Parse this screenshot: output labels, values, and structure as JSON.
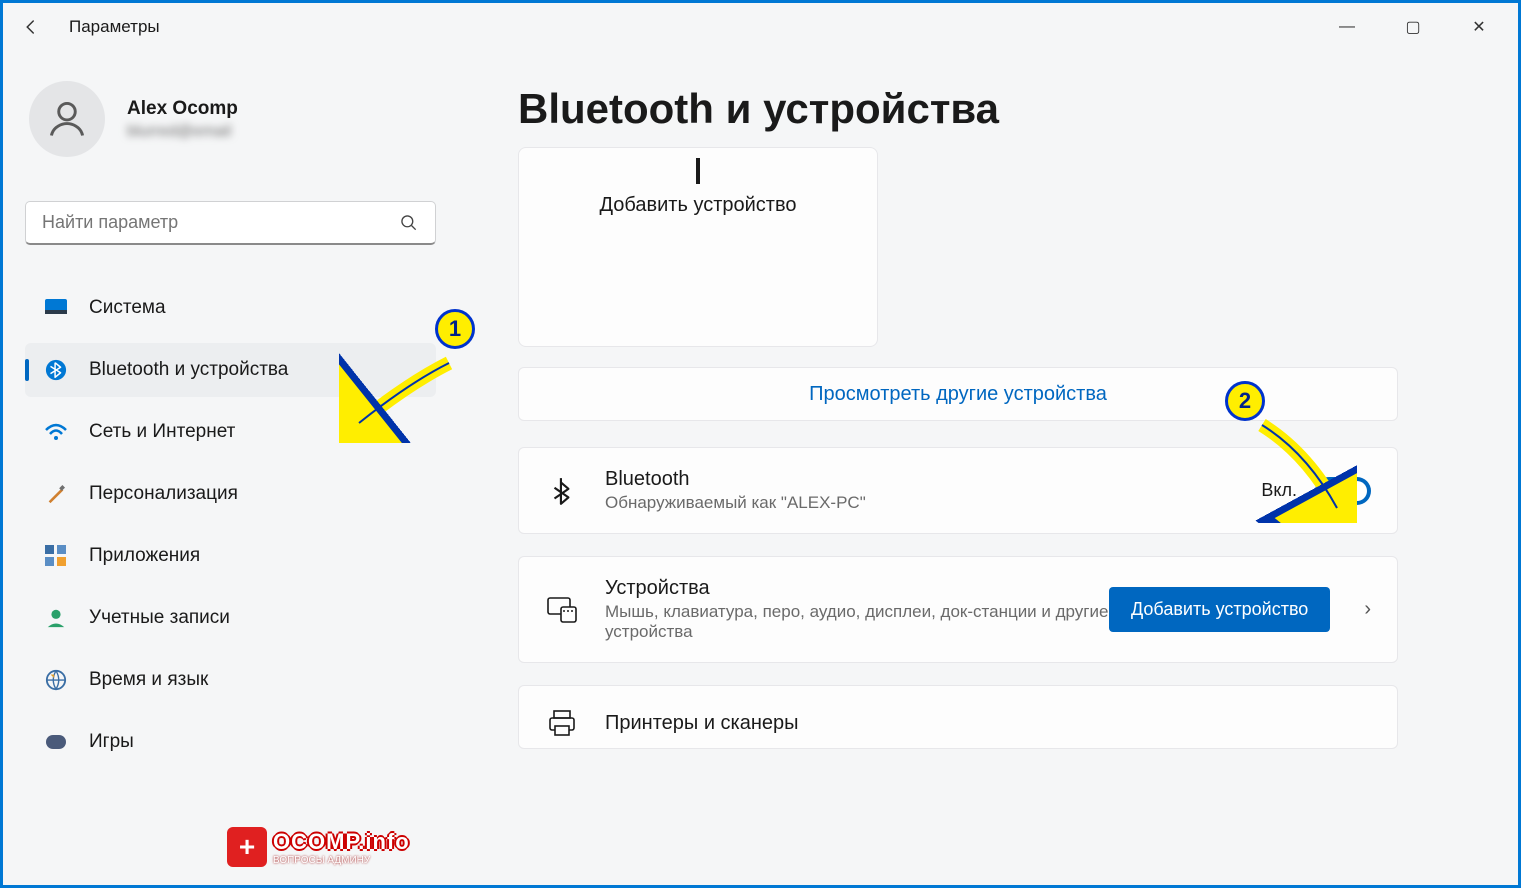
{
  "window": {
    "app_title": "Параметры"
  },
  "profile": {
    "name": "Alex Ocomp",
    "email": "blurred@email"
  },
  "search": {
    "placeholder": "Найти параметр"
  },
  "sidebar": {
    "items": [
      {
        "label": "Система",
        "icon": "system"
      },
      {
        "label": "Bluetooth и устройства",
        "icon": "bluetooth"
      },
      {
        "label": "Сеть и Интернет",
        "icon": "wifi"
      },
      {
        "label": "Персонализация",
        "icon": "brush"
      },
      {
        "label": "Приложения",
        "icon": "apps"
      },
      {
        "label": "Учетные записи",
        "icon": "accounts"
      },
      {
        "label": "Время и язык",
        "icon": "globe"
      },
      {
        "label": "Игры",
        "icon": "games"
      }
    ]
  },
  "main": {
    "title": "Bluetooth и устройства",
    "add_device_card": "Добавить устройство",
    "other_devices": "Просмотреть другие устройства",
    "bt_row": {
      "title": "Bluetooth",
      "subtitle": "Обнаруживаемый как \"ALEX-PC\"",
      "state_label": "Вкл.",
      "toggle_on": true
    },
    "devices_row": {
      "title": "Устройства",
      "subtitle": "Мышь, клавиатура, перо, аудио, дисплеи, док-станции и другие устройства",
      "button": "Добавить устройство"
    },
    "printers_row": {
      "title": "Принтеры и сканеры"
    }
  },
  "annotations": {
    "marker1": "1",
    "marker2": "2"
  },
  "watermark": {
    "main": "OCOMP.info",
    "sub": "ВОПРОСЫ АДМИНУ"
  }
}
